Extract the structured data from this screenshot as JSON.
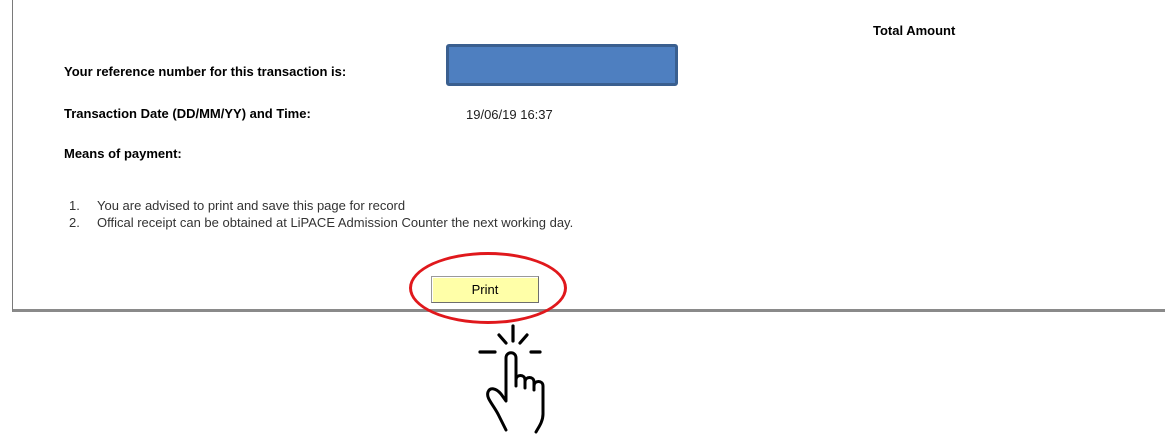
{
  "receipt": {
    "total_amount_label": "Total Amount",
    "reference_label": "Your reference number for this transaction is:",
    "reference_value_redacted": true,
    "date_label": "Transaction Date (DD/MM/YY) and Time:",
    "date_value": "19/06/19 16:37",
    "means_label": "Means of payment:"
  },
  "notes": [
    {
      "num": "1.",
      "text": "You are advised to print and save this page for record"
    },
    {
      "num": "2.",
      "text": "Offical receipt can be obtained at LiPACE Admission Counter the next working day."
    }
  ],
  "actions": {
    "print_label": "Print"
  },
  "annotations": {
    "highlight_color": "#e0181c",
    "cursor_icon": "hand-pointer-click-icon"
  },
  "colors": {
    "redaction_fill": "#4e7fc0",
    "print_button_fill": "#ffffa8"
  }
}
